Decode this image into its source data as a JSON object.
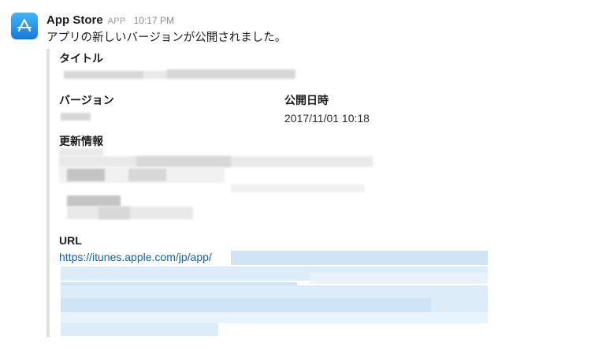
{
  "app": {
    "sender_name": "App Store",
    "app_tag": "APP",
    "timestamp": "10:17 PM",
    "message": "アプリの新しいバージョンが公開されました。",
    "avatar_icon": "app-store-icon",
    "avatar_color": "#1a78dd"
  },
  "attachment": {
    "title_label": "タイトル",
    "version_label": "バージョン",
    "published_label": "公開日時",
    "published_value": "2017/11/01 10:18",
    "update_info_label": "更新情報",
    "url_label": "URL",
    "url_visible": "https://itunes.apple.com/jp/app/",
    "link_color": "#1264a3",
    "border_color": "#e0e0e0"
  }
}
